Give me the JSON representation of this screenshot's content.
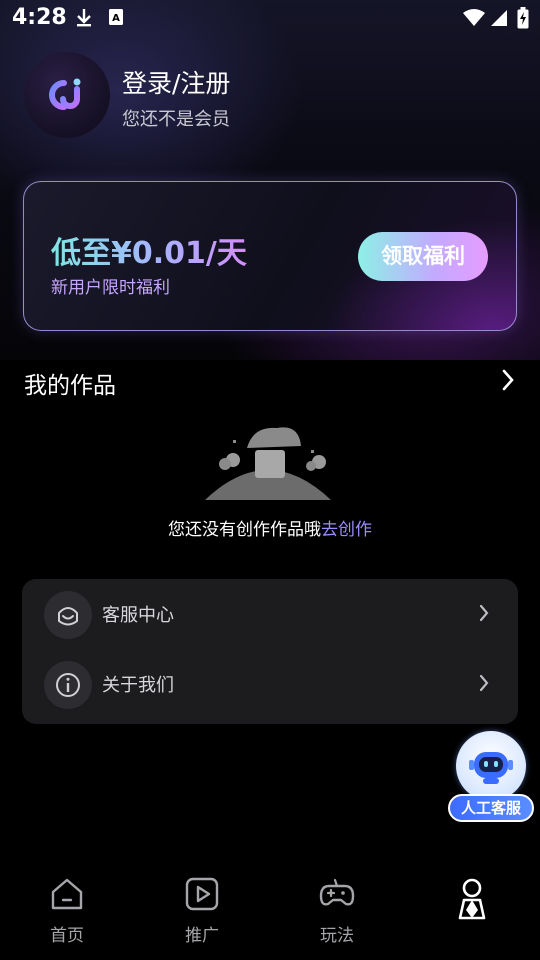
{
  "status_bar": {
    "time": "4:28",
    "icons": [
      "download-icon",
      "a-box-icon",
      "wifi-icon",
      "signal-icon",
      "battery-charging-icon"
    ]
  },
  "profile": {
    "title": "登录/注册",
    "subtitle": "您还不是会员",
    "avatar_icon": "app-logo-icon"
  },
  "promo": {
    "price": "低至¥0.01/天",
    "subtitle": "新用户限时福利",
    "button": "领取福利"
  },
  "works": {
    "title": "我的作品",
    "empty_text": "您还没有创作作品哦",
    "create_link": "去创作"
  },
  "menu": {
    "items": [
      {
        "label": "客服中心",
        "icon": "headset-smile-icon"
      },
      {
        "label": "关于我们",
        "icon": "info-icon"
      }
    ]
  },
  "fab": {
    "label": "人工客服",
    "icon": "robot-icon"
  },
  "nav": {
    "items": [
      {
        "label": "首页",
        "icon": "home-icon"
      },
      {
        "label": "推广",
        "icon": "play-box-icon"
      },
      {
        "label": "玩法",
        "icon": "gamepad-icon"
      },
      {
        "label": "",
        "icon": "person-icon",
        "active": true
      }
    ]
  },
  "colors": {
    "accent_purple": "#9b8cff",
    "promo_sub": "#c6a6ff",
    "fab_blue": "#3d6bff"
  }
}
